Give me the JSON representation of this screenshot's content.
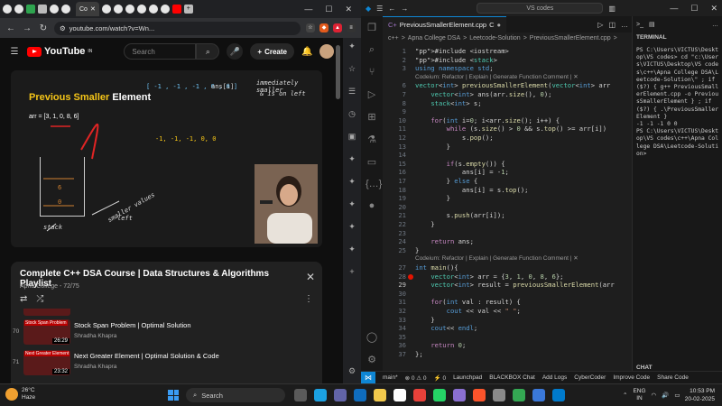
{
  "browser": {
    "tab_title": "Co",
    "url": "youtube.com/watch?v=Wn...",
    "window_controls": [
      "—",
      "☐",
      "✕"
    ]
  },
  "youtube": {
    "logo_text": "YouTube",
    "logo_region": "IN",
    "search_placeholder": "Search",
    "create_label": "Create",
    "video": {
      "slide_title_main": "Previous Smaller",
      "slide_title_rest": "Element",
      "array_text": "arr = [3, 1, 0, 8, 6]",
      "chalk_result": "[ -1 , -1 , -1 , 0 , 0 ]",
      "chalk_ans": "ans[i]",
      "chalk_note1": "immediately smaller",
      "chalk_note2": "& is on left",
      "chalk_yellow": "-1, -1, -1, 0, 0",
      "stack_label": "stack",
      "stack_val1": "6",
      "stack_val2": "0",
      "smaller_note": "smaller values",
      "left_note": "left"
    },
    "playlist": {
      "title": "Complete C++ DSA Course | Data Structures & Algorithms Playlist",
      "channel": "Apna College",
      "progress": "72/75",
      "items": [
        {
          "num": "70",
          "thumb_label": "Stock Span Problem",
          "duration": "26:29",
          "title": "Stock Span Problem | Optimal Solution",
          "author": "Shradha Khapra"
        },
        {
          "num": "71",
          "thumb_label": "Next Greater Element",
          "duration": "23:32",
          "title": "Next Greater Element | Optimal Solution & Code",
          "author": "Shradha Khapra"
        }
      ]
    }
  },
  "vscode": {
    "search_text": "VS codes",
    "tab_label": "PreviousSmallerElement.cpp",
    "tab_modified": "C",
    "breadcrumb": [
      "c++",
      ">",
      "Apna College DSA",
      ">",
      "Leetcode-Solution",
      ">",
      "PreviousSmallerElement.cpp",
      ">"
    ],
    "codelens_label": "Codeium: Refactor | Explain | Generate Function Comment | ✕",
    "code_lines": [
      {
        "n": "1",
        "t": "#include <iostream>"
      },
      {
        "n": "2",
        "t": "#include <stack>"
      },
      {
        "n": "3",
        "t": "using namespace std;"
      },
      {
        "n": "",
        "lens": true
      },
      {
        "n": "6",
        "t": "vector<int> previousSmallerElement(vector<int> arr"
      },
      {
        "n": "7",
        "t": "    vector<int> ans(arr.size(), 0);"
      },
      {
        "n": "8",
        "t": "    stack<int> s;"
      },
      {
        "n": "9",
        "t": ""
      },
      {
        "n": "10",
        "t": "    for(int i=0; i<arr.size(); i++) {"
      },
      {
        "n": "11",
        "t": "        while (s.size() > 0 && s.top() >= arr[i])"
      },
      {
        "n": "12",
        "t": "            s.pop();"
      },
      {
        "n": "13",
        "t": "        }"
      },
      {
        "n": "14",
        "t": ""
      },
      {
        "n": "15",
        "t": "        if(s.empty()) {"
      },
      {
        "n": "16",
        "t": "            ans[i] = -1;"
      },
      {
        "n": "17",
        "t": "        } else {"
      },
      {
        "n": "18",
        "t": "            ans[i] = s.top();"
      },
      {
        "n": "19",
        "t": "        }"
      },
      {
        "n": "20",
        "t": ""
      },
      {
        "n": "21",
        "t": "        s.push(arr[i]);"
      },
      {
        "n": "22",
        "t": "    }"
      },
      {
        "n": "23",
        "t": ""
      },
      {
        "n": "24",
        "t": "    return ans;"
      },
      {
        "n": "25",
        "t": "}"
      },
      {
        "n": "",
        "lens": true
      },
      {
        "n": "27",
        "t": "int main(){"
      },
      {
        "n": "28",
        "t": "    vector<int> arr = {3, 1, 0, 8, 6};",
        "bp": true
      },
      {
        "n": "29",
        "t": "    vector<int> result = previousSmallerElement(arr",
        "cur": true
      },
      {
        "n": "30",
        "t": ""
      },
      {
        "n": "31",
        "t": "    for(int val : result) {"
      },
      {
        "n": "32",
        "t": "        cout << val << \" \";"
      },
      {
        "n": "33",
        "t": "    }"
      },
      {
        "n": "34",
        "t": "    cout<< endl;"
      },
      {
        "n": "35",
        "t": ""
      },
      {
        "n": "36",
        "t": "    return 0;"
      },
      {
        "n": "37",
        "t": "};"
      }
    ],
    "terminal": {
      "title": "TERMINAL",
      "output": "PS C:\\Users\\VICTUS\\Desktop\\VS codes> cd \"c:\\Users\\VICTUS\\Desktop\\VS codes\\c++\\Apna College DSA\\Leetcode-Solution\\\" ; if ($?) { g++ PreviousSmallerElement.cpp -o PreviousSmallerElement } ; if ($?) { .\\PreviousSmallerElement }\n-1 -1 -1 0 0\nPS C:\\Users\\VICTUS\\Desktop\\VS codes\\c++\\Apna College DSA\\Leetcode-Solution> ",
      "chat_label": "CHAT"
    },
    "status": {
      "branch": "main*",
      "errors": "⊗ 0 ⚠ 0",
      "ports": "⚡ 0",
      "launchpad": "Launchpad",
      "blackbox": "BLACKBOX Chat",
      "add_logs": "Add Logs",
      "cybercoder": "CyberCoder",
      "improve": "Improve Code",
      "share": "Share Code"
    }
  },
  "taskbar": {
    "temp": "26°C",
    "condition": "Haze",
    "search": "Search",
    "lang_top": "ENG",
    "lang_bottom": "IN",
    "time": "10:53 PM",
    "date": "20-02-2025"
  }
}
